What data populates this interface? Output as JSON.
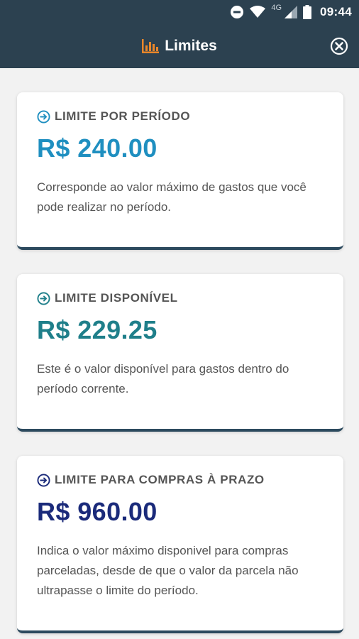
{
  "status_bar": {
    "network": "4G",
    "time": "09:44"
  },
  "app_bar": {
    "title": "Limites",
    "icon": "bar-chart-icon",
    "icon_color": "#e8862a",
    "close_icon": "close-circle-icon"
  },
  "colors": {
    "app_bar_bg": "#2c4150",
    "card_border": "#2c4a5e",
    "value_period": "#1f8fc0",
    "value_available": "#1f7f8a",
    "value_installments": "#1a2a7a",
    "background": "#f2f2f2"
  },
  "cards": [
    {
      "title": "LIMITE POR PERÍODO",
      "icon": "arrow-circle-right-icon",
      "icon_color": "#1f8fc0",
      "value": "R$ 240.00",
      "description": "Corresponde ao valor máximo de gastos que você pode realizar no período."
    },
    {
      "title": "LIMITE DISPONÍVEL",
      "icon": "arrow-circle-right-icon",
      "icon_color": "#1f7f8a",
      "value": "R$ 229.25",
      "description": "Este é o valor disponível para gastos dentro do período corrente."
    },
    {
      "title": "LIMITE PARA COMPRAS À PRAZO",
      "icon": "arrow-circle-right-icon",
      "icon_color": "#1a2a7a",
      "value": "R$ 960.00",
      "description": "Indica o valor máximo disponivel para compras parceladas, desde de que o valor da parcela não ultrapasse o limite do período."
    }
  ]
}
